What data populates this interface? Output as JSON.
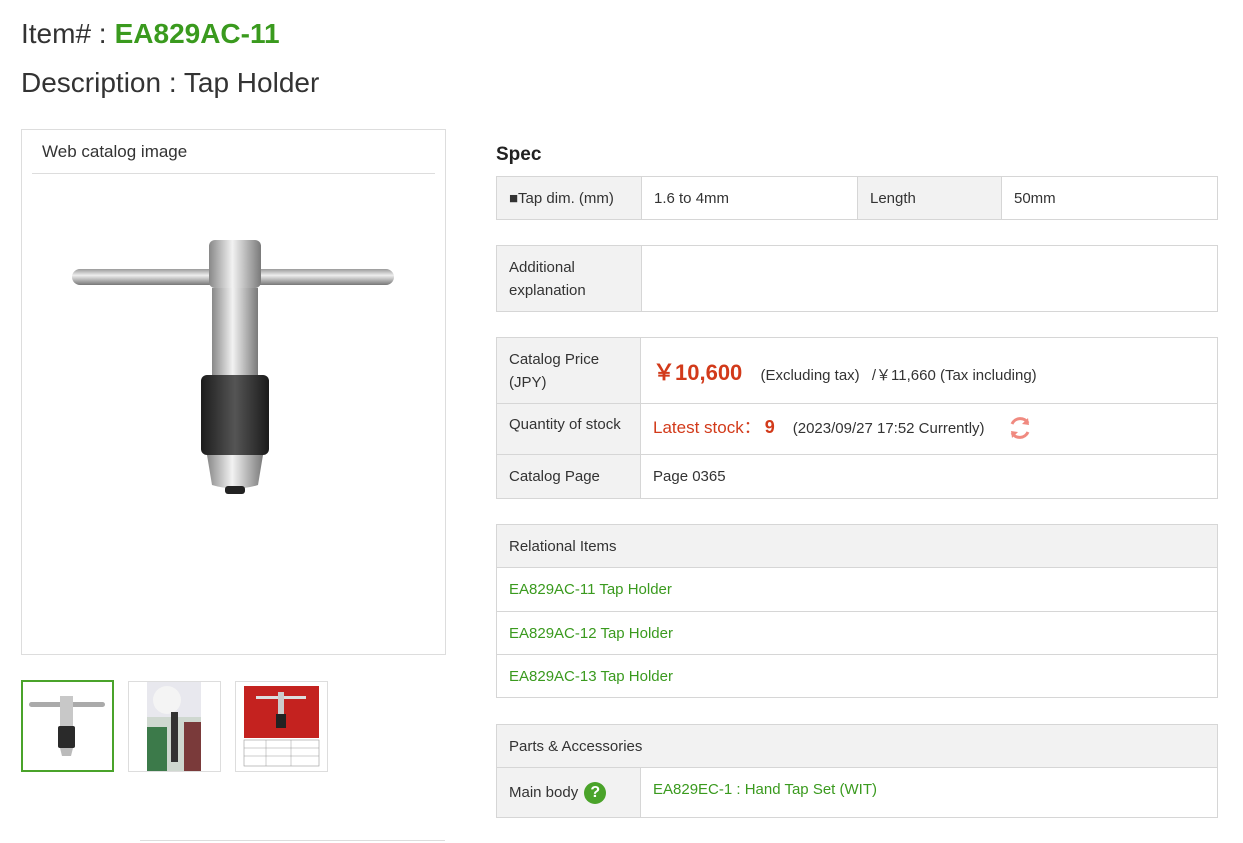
{
  "header": {
    "item_prefix": "Item# :",
    "item_code": "EA829AC-11",
    "description": "Description : Tap Holder"
  },
  "gallery": {
    "title": "Web catalog image",
    "thumbnails": [
      "thumbnail-1",
      "thumbnail-2",
      "thumbnail-3"
    ]
  },
  "spec": {
    "title": "Spec",
    "tap_dim_label": "■Tap dim. (mm)",
    "tap_dim_value": "1.6 to 4mm",
    "length_label": "Length",
    "length_value": "50mm"
  },
  "additional": {
    "label": "Additional explanation",
    "value": ""
  },
  "price": {
    "label": "Catalog Price (JPY)",
    "value": "￥10,600",
    "excl": "(Excluding tax)",
    "incl_value": "/￥11,660",
    "incl": "(Tax including)"
  },
  "stock": {
    "label": "Quantity of stock",
    "latest_label": "Latest stock：",
    "count": "9",
    "timestamp": "(2023/09/27 17:52 Currently)",
    "refresh_icon": "refresh-icon"
  },
  "catalog_page": {
    "label": "Catalog Page",
    "value": "Page 0365"
  },
  "relational": {
    "title": "Relational Items",
    "items": [
      "EA829AC-11 Tap Holder",
      "EA829AC-12 Tap Holder",
      "EA829AC-13 Tap Holder"
    ]
  },
  "parts": {
    "title": "Parts & Accessories",
    "main_body_label": "Main body",
    "help_icon": "?",
    "main_body_link": "EA829EC-1 : Hand Tap Set (WIT)"
  },
  "colors": {
    "accent_green": "#3a9a1e",
    "price_red": "#d23a1a"
  }
}
